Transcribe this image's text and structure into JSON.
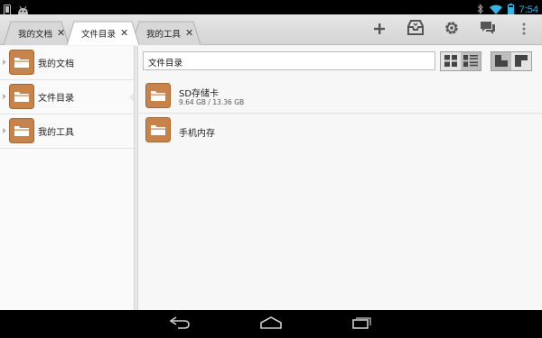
{
  "status_bar": {
    "left_icons": [
      "phone-icon",
      "android-debug-icon"
    ],
    "right_icons": [
      "bluetooth-icon",
      "wifi-icon",
      "battery-icon"
    ],
    "time": "7:54",
    "accent": "#33b5e5"
  },
  "tabs": [
    {
      "label": "我的文档",
      "active": false
    },
    {
      "label": "文件目录",
      "active": true
    },
    {
      "label": "我的工具",
      "active": false
    }
  ],
  "tab_close_glyph": "✕",
  "actions": [
    "plus-icon",
    "inbox-icon",
    "gear-icon",
    "chat-icon",
    "overflow-menu-icon"
  ],
  "left_pane": {
    "items": [
      {
        "label": "我的文档",
        "selected": false
      },
      {
        "label": "文件目录",
        "selected": true
      },
      {
        "label": "我的工具",
        "selected": false
      }
    ]
  },
  "main": {
    "path": "文件目录",
    "rows": [
      {
        "name": "SD存储卡",
        "detail": "9.64 GB / 13.36 GB"
      },
      {
        "name": "手机内存",
        "detail": ""
      }
    ],
    "view_modes": [
      "grid-view-icon",
      "detail-list-view-icon"
    ],
    "layout_modes": [
      "single-pane-icon",
      "dual-pane-icon"
    ]
  },
  "nav_bar": [
    "back-icon",
    "home-icon",
    "recents-icon"
  ],
  "colors": {
    "folder": "#c7834a",
    "folder_dark": "#a9672f",
    "tab_active": "#ffffff"
  }
}
